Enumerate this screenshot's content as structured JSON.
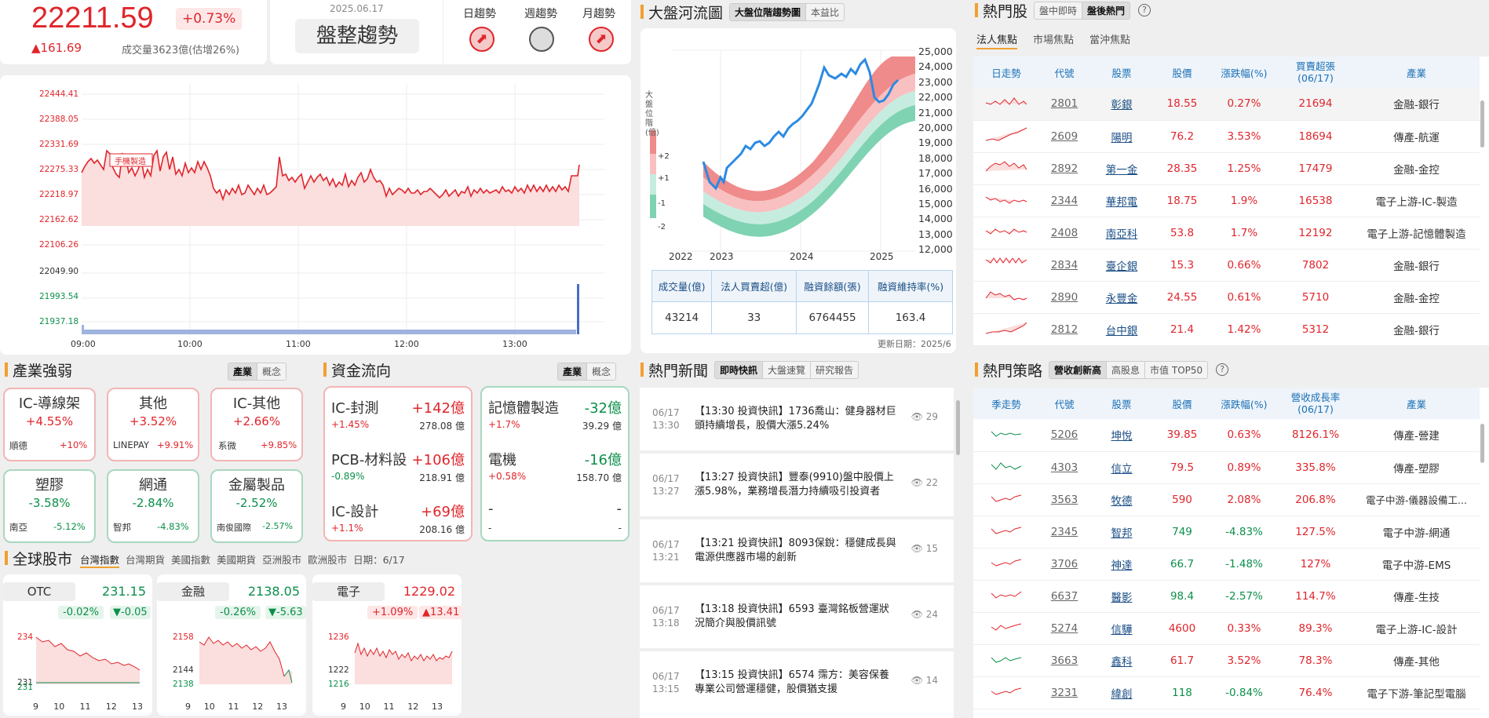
{
  "index": {
    "value": "22211.59",
    "pct": "+0.73%",
    "change": "▲161.69",
    "volume": "成交量3623億(估增26%)",
    "date": "2025.06.17",
    "trend": "盤整趨勢",
    "trend_labels": [
      "日趨勢",
      "週趨勢",
      "月趨勢"
    ]
  },
  "intraday": {
    "yticks": [
      "22444.41",
      "22388.05",
      "22331.69",
      "22275.33",
      "22218.97",
      "22162.62",
      "22106.26",
      "22049.90"
    ],
    "vticks": [
      "21993.54",
      "21937.18"
    ],
    "xticks": [
      "09:00",
      "10:00",
      "11:00",
      "12:00",
      "13:00"
    ],
    "annotation": "手機製造"
  },
  "river": {
    "title": "大盤河流圖",
    "tabs": [
      "大盤位階趨勢圖",
      "本益比"
    ],
    "ylabel": "大盤位階(倍)",
    "levels": [
      "+2",
      "+1",
      "-1",
      "-2"
    ],
    "yticks": [
      "25,000",
      "24,000",
      "23,000",
      "22,000",
      "21,000",
      "20,000",
      "19,000",
      "18,000",
      "17,000",
      "16,000",
      "15,000",
      "14,000",
      "13,000",
      "12,000"
    ],
    "xticks": [
      "2022",
      "2023",
      "2024",
      "2025"
    ],
    "stats_headers": [
      "成交量(億)",
      "法人買賣超(億)",
      "融資餘額(張)",
      "融資維持率(%)"
    ],
    "stats_values": [
      "43214",
      "33",
      "6764455",
      "163.4"
    ],
    "updated": "更新日期：2025/6"
  },
  "hot": {
    "title": "熱門股",
    "tabs": [
      "盤中即時",
      "盤後熱門"
    ],
    "subtabs": [
      "法人焦點",
      "市場焦點",
      "當沖焦點"
    ],
    "headers": [
      "日走勢",
      "代號",
      "股票",
      "股價",
      "漲跌幅(%)",
      "買賣超張\n(06/17)",
      "產業"
    ],
    "rows": [
      {
        "code": "2801",
        "name": "彰銀",
        "price": "18.55",
        "pct": "0.27%",
        "vol": "21694",
        "ind": "金融-銀行"
      },
      {
        "code": "2609",
        "name": "陽明",
        "price": "76.2",
        "pct": "3.53%",
        "vol": "18694",
        "ind": "傳產-航運"
      },
      {
        "code": "2892",
        "name": "第一金",
        "price": "28.35",
        "pct": "1.25%",
        "vol": "17479",
        "ind": "金融-金控"
      },
      {
        "code": "2344",
        "name": "華邦電",
        "price": "18.75",
        "pct": "1.9%",
        "vol": "16538",
        "ind": "電子上游-IC-製造"
      },
      {
        "code": "2408",
        "name": "南亞科",
        "price": "53.8",
        "pct": "1.7%",
        "vol": "12192",
        "ind": "電子上游-記憶體製造"
      },
      {
        "code": "2834",
        "name": "臺企銀",
        "price": "15.3",
        "pct": "0.66%",
        "vol": "7802",
        "ind": "金融-銀行"
      },
      {
        "code": "2890",
        "name": "永豐金",
        "price": "24.55",
        "pct": "0.61%",
        "vol": "5710",
        "ind": "金融-金控"
      },
      {
        "code": "2812",
        "name": "台中銀",
        "price": "21.4",
        "pct": "1.42%",
        "vol": "5312",
        "ind": "金融-銀行"
      }
    ]
  },
  "strategy": {
    "title": "熱門策略",
    "tabs": [
      "營收創新高",
      "高股息",
      "市值 TOP50"
    ],
    "headers": [
      "季走勢",
      "代號",
      "股票",
      "股價",
      "漲跌幅(%)",
      "營收成長率\n(06/17)",
      "產業"
    ],
    "rows": [
      {
        "code": "5206",
        "name": "坤悅",
        "price": "39.85",
        "pct": "0.63%",
        "g": "8126.1%",
        "ind": "傳產-營建",
        "neg": false
      },
      {
        "code": "4303",
        "name": "信立",
        "price": "79.5",
        "pct": "0.89%",
        "g": "335.8%",
        "ind": "傳產-塑膠",
        "neg": false
      },
      {
        "code": "3563",
        "name": "牧德",
        "price": "590",
        "pct": "2.08%",
        "g": "206.8%",
        "ind": "電子中游-儀器設備工...",
        "neg": false
      },
      {
        "code": "2345",
        "name": "智邦",
        "price": "749",
        "pct": "-4.83%",
        "g": "127.5%",
        "ind": "電子中游-網通",
        "neg": true
      },
      {
        "code": "3706",
        "name": "神達",
        "price": "66.7",
        "pct": "-1.48%",
        "g": "127%",
        "ind": "電子中游-EMS",
        "neg": true
      },
      {
        "code": "6637",
        "name": "醫影",
        "price": "98.4",
        "pct": "-2.57%",
        "g": "114.7%",
        "ind": "傳產-生技",
        "neg": true
      },
      {
        "code": "5274",
        "name": "信驊",
        "price": "4600",
        "pct": "0.33%",
        "g": "89.3%",
        "ind": "電子上游-IC-設計",
        "neg": false
      },
      {
        "code": "3663",
        "name": "鑫科",
        "price": "61.7",
        "pct": "3.52%",
        "g": "78.3%",
        "ind": "傳產-其他",
        "neg": false
      },
      {
        "code": "3231",
        "name": "緯創",
        "price": "118",
        "pct": "-0.84%",
        "g": "76.4%",
        "ind": "電子下游-筆記型電腦",
        "neg": true
      }
    ]
  },
  "sector": {
    "title": "產業強弱",
    "tabs": [
      "產業",
      "概念"
    ],
    "boxes": [
      {
        "name": "IC-導線架",
        "pct": "+4.55%",
        "stock": "順德",
        "spct": "+10%",
        "up": true
      },
      {
        "name": "其他",
        "pct": "+3.52%",
        "stock": "LINEPAY",
        "spct": "+9.91%",
        "up": true
      },
      {
        "name": "IC-其他",
        "pct": "+2.66%",
        "stock": "系微",
        "spct": "+9.85%",
        "up": true
      },
      {
        "name": "塑膠",
        "pct": "-3.58%",
        "stock": "南亞",
        "spct": "-5.12%",
        "up": false
      },
      {
        "name": "網通",
        "pct": "-2.84%",
        "stock": "智邦",
        "spct": "-4.83%",
        "up": false
      },
      {
        "name": "金屬製品",
        "pct": "-2.52%",
        "stock": "南俊國際",
        "spct": "-2.57%",
        "up": false
      }
    ]
  },
  "flow": {
    "title": "資金流向",
    "tabs": [
      "產業",
      "概念"
    ],
    "inflow": [
      {
        "name": "IC-封測",
        "amt": "+142億",
        "pct": "+1.45%",
        "total": "278.08 億"
      },
      {
        "name": "PCB-材料設",
        "amt": "+106億",
        "pct": "-0.89%",
        "total": "218.91 億"
      },
      {
        "name": "IC-設計",
        "amt": "+69億",
        "pct": "+1.1%",
        "total": "208.16 億"
      }
    ],
    "outflow": [
      {
        "name": "記憶體製造",
        "amt": "-32億",
        "pct": "+1.7%",
        "total": "39.29 億"
      },
      {
        "name": "電機",
        "amt": "-16億",
        "pct": "+0.58%",
        "total": "158.70 億"
      },
      {
        "name": "-",
        "amt": "-",
        "pct": "-",
        "total": "-"
      }
    ]
  },
  "global": {
    "title": "全球股市",
    "tabs": [
      "台灣指數",
      "台灣期貨",
      "美國指數",
      "美國期貨",
      "亞洲股市",
      "歐洲股市"
    ],
    "date": "日期：6/17",
    "cards": [
      {
        "name": "OTC",
        "value": "231.15",
        "pct": "-0.02%",
        "chg": "▼-0.05",
        "up": false,
        "yt": [
          "234",
          "231",
          "231"
        ],
        "xt": [
          "9",
          "10",
          "11",
          "12",
          "13"
        ]
      },
      {
        "name": "金融",
        "value": "2138.05",
        "pct": "-0.26%",
        "chg": "▼-5.63",
        "up": false,
        "yt": [
          "2158",
          "2144",
          "2138"
        ],
        "xt": [
          "9",
          "10",
          "11",
          "12",
          "13"
        ]
      },
      {
        "name": "電子",
        "value": "1229.02",
        "pct": "+1.09%",
        "chg": "▲13.41",
        "up": true,
        "yt": [
          "1236",
          "1222",
          "1216"
        ],
        "xt": [
          "9",
          "10",
          "11",
          "12",
          "13"
        ]
      }
    ]
  },
  "news": {
    "title": "熱門新聞",
    "tabs": [
      "即時快訊",
      "大盤速覽",
      "研究報告"
    ],
    "items": [
      {
        "date": "06/17",
        "time": "13:30",
        "text": "【13:30 投資快訊】1736喬山：健身器材巨頭持續增長，股價大漲5.24%",
        "views": "29"
      },
      {
        "date": "06/17",
        "time": "13:27",
        "text": "【13:27 投資快訊】豐泰(9910)盤中股價上漲5.98%，業務增長潛力持續吸引投資者",
        "views": "22"
      },
      {
        "date": "06/17",
        "time": "13:21",
        "text": "【13:21 投資快訊】8093保銳：穩健成長與電源供應器市場的創新",
        "views": "15"
      },
      {
        "date": "06/17",
        "time": "13:18",
        "text": "【13:18 投資快訊】6593 臺灣銘板營運狀況簡介與股價訊號",
        "views": "24"
      },
      {
        "date": "06/17",
        "time": "13:15",
        "text": "【13:15 投資快訊】6574 霈方：美容保養專業公司營運穩健，股價猶支援",
        "views": "14"
      }
    ]
  },
  "colors": {
    "up": "#e0252b",
    "down": "#0c8f4a",
    "accent": "#f0a030"
  }
}
